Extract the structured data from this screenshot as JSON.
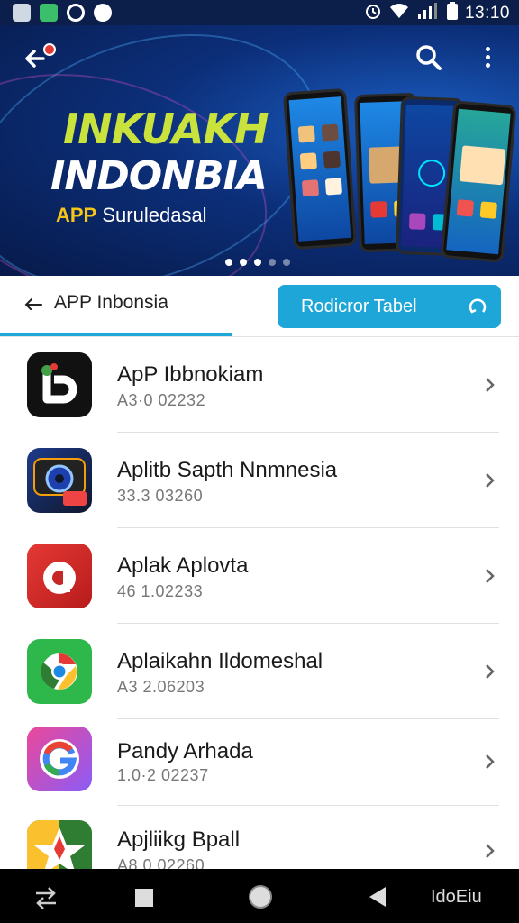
{
  "status_bar": {
    "time": "13:10",
    "icons": [
      "gallery-icon",
      "app-icon",
      "sync-icon",
      "dot-icon",
      "alarm-icon",
      "wifi-icon",
      "signal-icon",
      "battery-icon"
    ]
  },
  "banner": {
    "title_line1": "INKUAKH",
    "title_line2": "INDONBIA",
    "subtitle_accent": "APP",
    "subtitle_rest": "Surulеdasal",
    "carousel": {
      "count": 5,
      "active": 3
    }
  },
  "tabs": {
    "active_label": "APP Inbonsia",
    "button_label": "Rodicror Tabel"
  },
  "apps": [
    {
      "name": "ApP Ibbnokiam",
      "sub": "A3·0 02232",
      "icon": "b-logo-icon"
    },
    {
      "name": "Aplitb Sapth Nnmnesia",
      "sub": "33.3 03260",
      "icon": "camera-app-icon"
    },
    {
      "name": "Aplak Aplovta",
      "sub": "46 1.02233",
      "icon": "red-a-app-icon"
    },
    {
      "name": "Aplaikahn Ildomeshal",
      "sub": "A3 2.06203",
      "icon": "chrome-app-icon"
    },
    {
      "name": "Pandy Arhada",
      "sub": "1.0·2 02237",
      "icon": "g-app-icon"
    },
    {
      "name": "Apjliikg Bpall",
      "sub": "A8.0 02260",
      "icon": "star-app-icon"
    }
  ],
  "nav_bar": {
    "right_label": "IdoEiu"
  },
  "colors": {
    "accent": "#1ea6d8",
    "banner_dark": "#071a4a",
    "title_green": "#c9e33c",
    "subtitle_gold": "#f5c518"
  }
}
